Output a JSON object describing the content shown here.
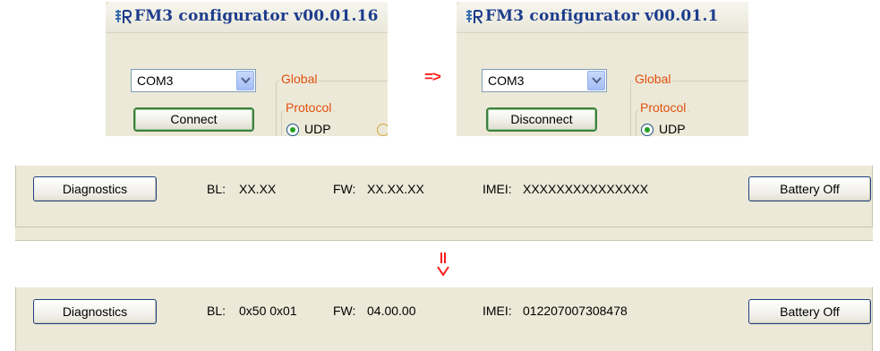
{
  "before_window": {
    "title": "FM3 configurator v00.01.16",
    "port_value": "COM3",
    "connect_button": "Connect",
    "global_label": "Global",
    "protocol_label": "Protocol",
    "protocol_option": "UDP"
  },
  "transition_arrow": "=>",
  "after_window": {
    "title": "FM3 configurator v00.01.1",
    "port_value": "COM3",
    "connect_button": "Disconnect",
    "global_label": "Global",
    "protocol_label": "Protocol",
    "protocol_option": "UDP"
  },
  "diagnostics_before": {
    "diagnostics_button": "Diagnostics",
    "bl_label": "BL:",
    "bl_value": "XX.XX",
    "fw_label": "FW:",
    "fw_value": "XX.XX.XX",
    "imei_label": "IMEI:",
    "imei_value": "XXXXXXXXXXXXXXX",
    "battery_button": "Battery Off"
  },
  "diagnostics_after": {
    "diagnostics_button": "Diagnostics",
    "bl_label": "BL:",
    "bl_value": "0x50 0x01",
    "fw_label": "FW:",
    "fw_value": "04.00.00",
    "imei_label": "IMEI:",
    "imei_value": "012207007308478",
    "battery_button": "Battery Off"
  },
  "colors": {
    "arrow": "#ff1a1a",
    "group_label": "#e0500e",
    "title_text": "#1c3c8c",
    "window_bg": "#ece9d8"
  }
}
